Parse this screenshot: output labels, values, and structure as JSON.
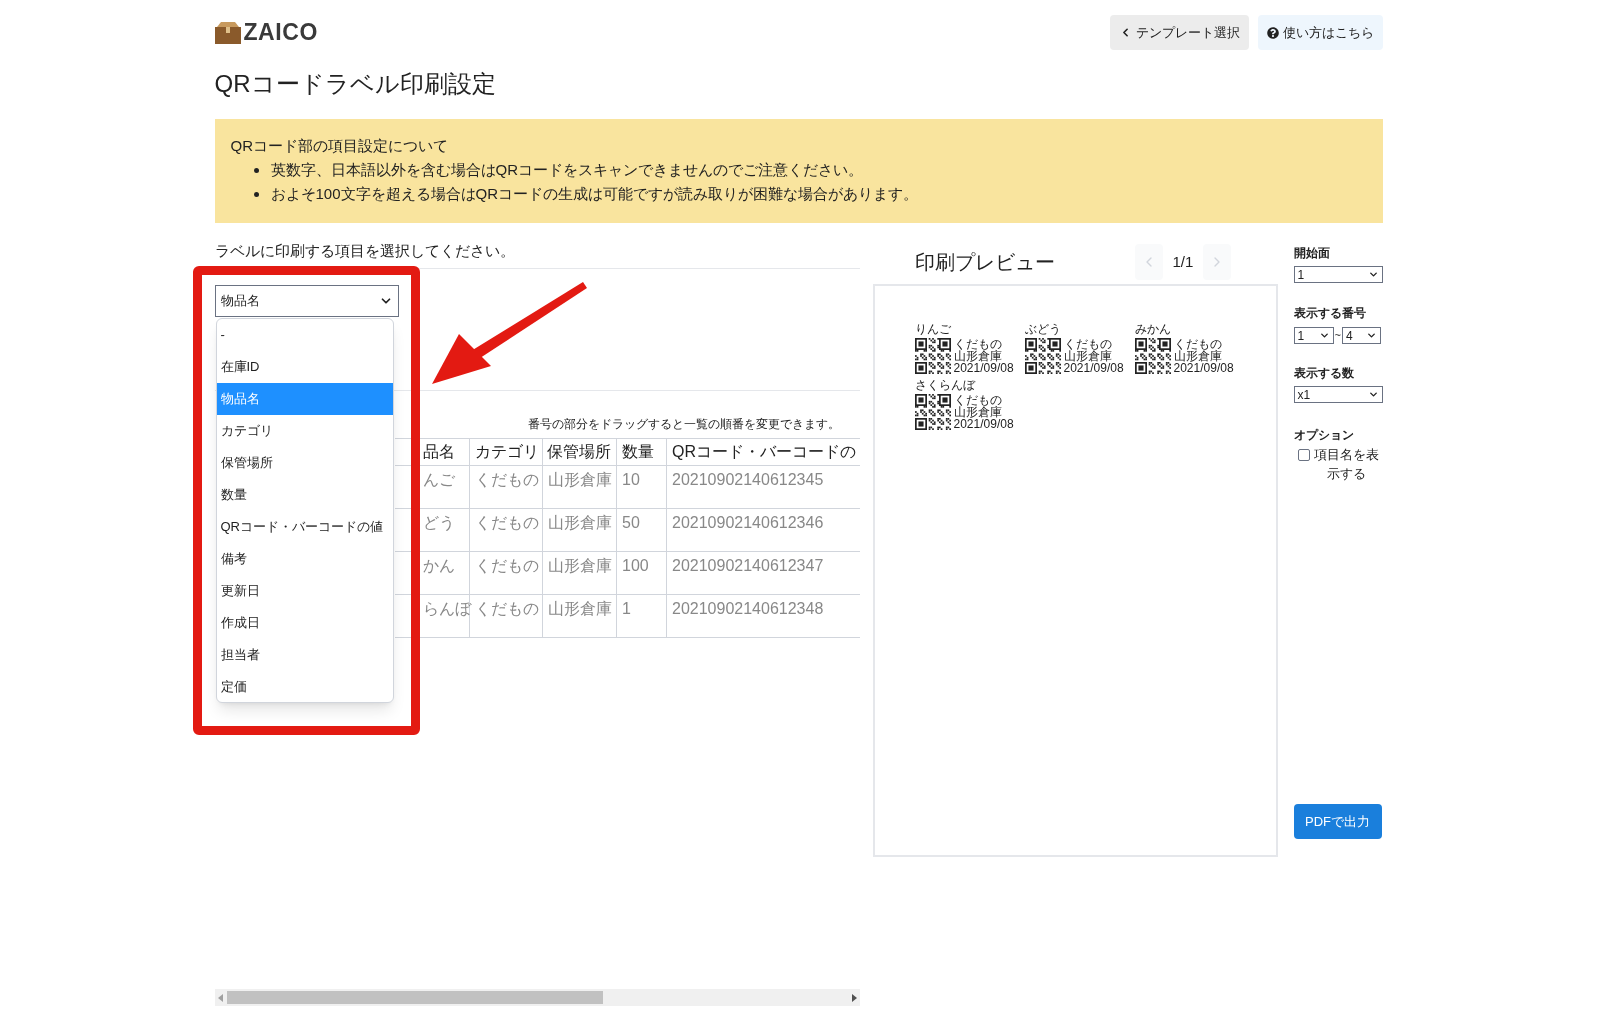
{
  "header": {
    "logo": "ZAICO",
    "buttons": [
      {
        "kind": "back",
        "label": "テンプレート選択"
      },
      {
        "kind": "help",
        "label": "使い方はこちら"
      }
    ]
  },
  "title": "QRコードラベル印刷設定",
  "notice": {
    "heading": "QRコード部の項目設定について",
    "items": [
      "英数字、日本語以外を含む場合はQRコードをスキャンできませんのでご注意ください。",
      "およそ100文字を超える場合はQRコードの生成は可能ですが読み取りが困難な場合があります。"
    ]
  },
  "field_selector": {
    "prompt": "ラベルに印刷する項目を選択してください。",
    "value": "物品名",
    "options": [
      {
        "label": "-",
        "selected": false
      },
      {
        "label": "在庫ID",
        "selected": false
      },
      {
        "label": "物品名",
        "selected": true
      },
      {
        "label": "カテゴリ",
        "selected": false
      },
      {
        "label": "保管場所",
        "selected": false
      },
      {
        "label": "数量",
        "selected": false
      },
      {
        "label": "QRコード・バーコードの値",
        "selected": false
      },
      {
        "label": "備考",
        "selected": false
      },
      {
        "label": "更新日",
        "selected": false
      },
      {
        "label": "作成日",
        "selected": false
      },
      {
        "label": "担当者",
        "selected": false
      },
      {
        "label": "定価",
        "selected": false
      }
    ]
  },
  "table": {
    "note": "番号の部分をドラッグすると一覧の順番を変更できます。",
    "columns": [
      "品名",
      "カテゴリ",
      "保管場所",
      "数量",
      "QRコード・バーコードの"
    ],
    "rows": [
      [
        "んご",
        "くだもの",
        "山形倉庫",
        "10",
        "20210902140612345"
      ],
      [
        "どう",
        "くだもの",
        "山形倉庫",
        "50",
        "20210902140612346"
      ],
      [
        "かん",
        "くだもの",
        "山形倉庫",
        "100",
        "20210902140612347"
      ],
      [
        "らんぼ",
        "くだもの",
        "山形倉庫",
        "1",
        "20210902140612348"
      ]
    ]
  },
  "preview": {
    "title": "印刷プレビュー",
    "page": "1/1",
    "labels": [
      {
        "name": "りんご",
        "lines": [
          "くだもの",
          "山形倉庫",
          "2021/09/08"
        ]
      },
      {
        "name": "ぶどう",
        "lines": [
          "くだもの",
          "山形倉庫",
          "2021/09/08"
        ]
      },
      {
        "name": "みかん",
        "lines": [
          "くだもの",
          "山形倉庫",
          "2021/09/08"
        ]
      },
      {
        "name": "さくらんぼ",
        "lines": [
          "くだもの",
          "山形倉庫",
          "2021/09/08"
        ]
      }
    ]
  },
  "settings": {
    "start_page": {
      "label": "開始面",
      "value": "1"
    },
    "number_range": {
      "label": "表示する番号",
      "from": "1",
      "separator": "~",
      "to": "4"
    },
    "count": {
      "label": "表示する数",
      "value": "x1"
    },
    "options": {
      "label": "オプション",
      "checkbox": {
        "label": "項目名を表示する",
        "checked": false
      }
    },
    "export_button": "PDFで出力"
  }
}
